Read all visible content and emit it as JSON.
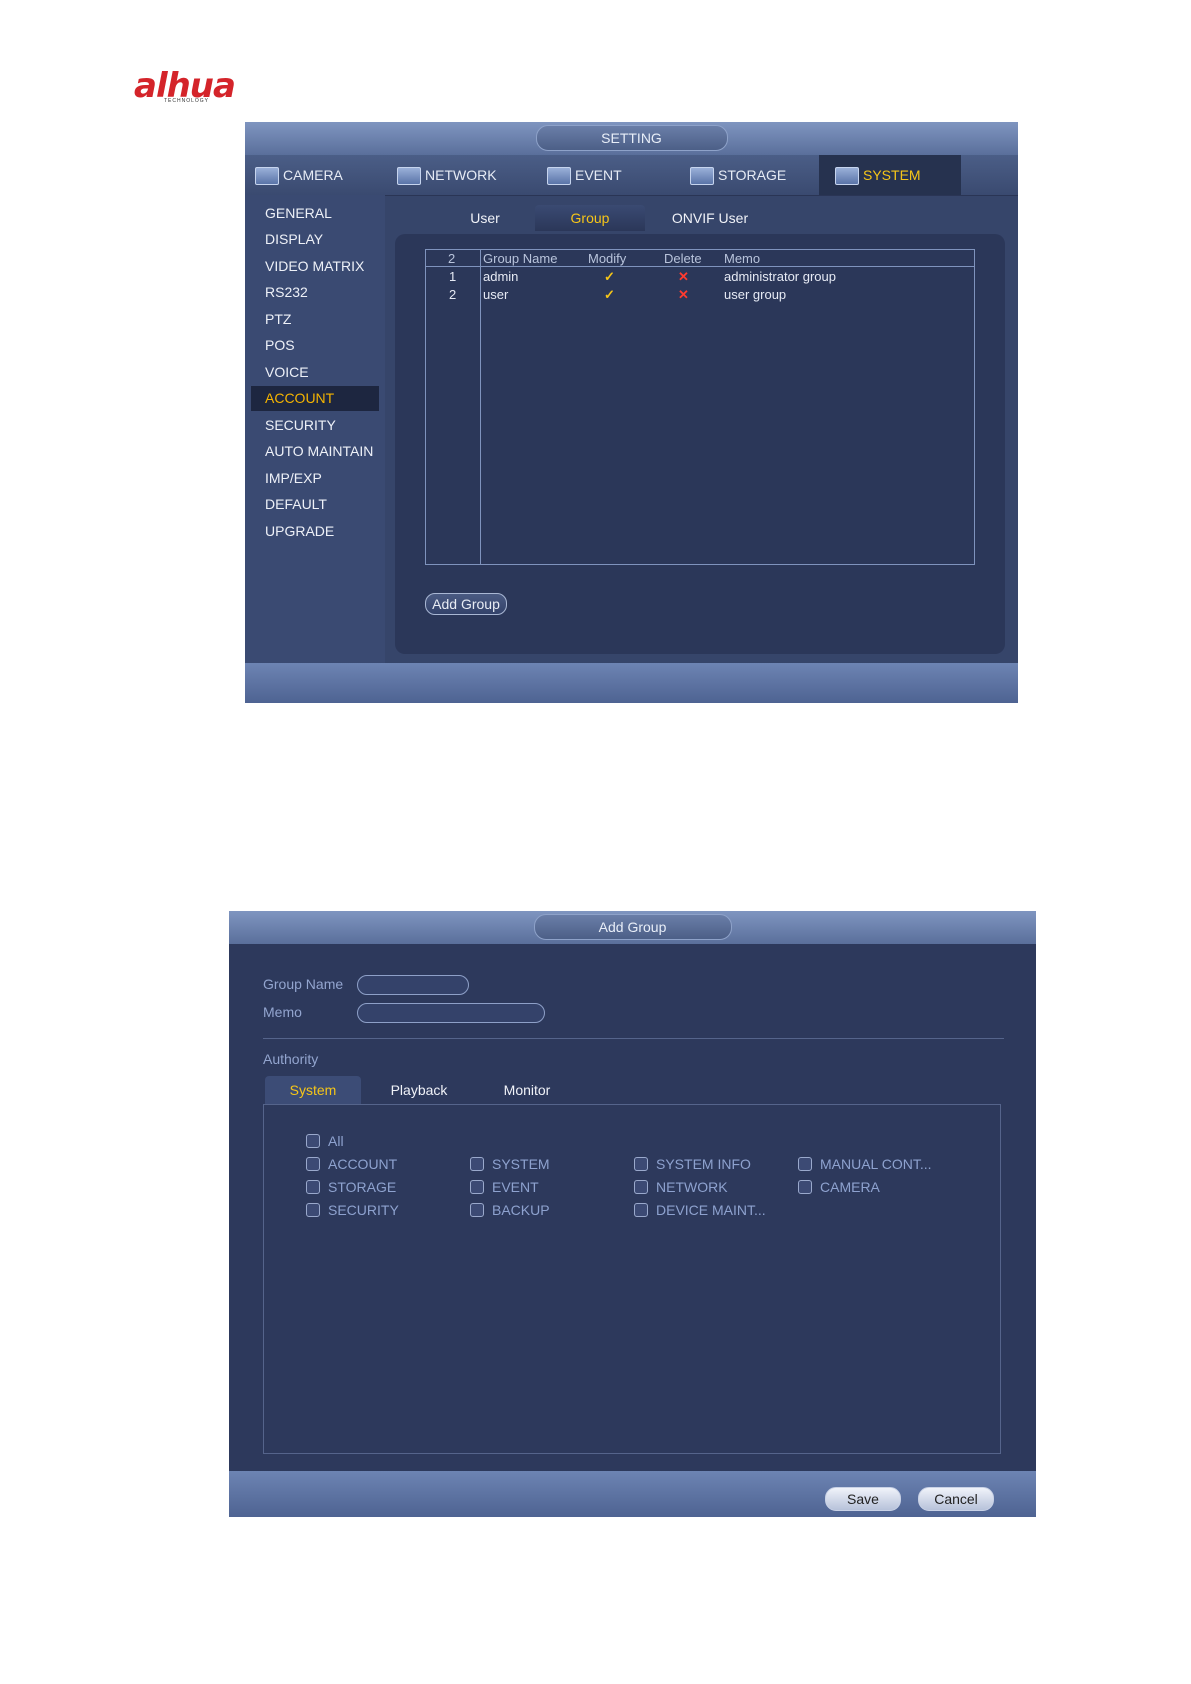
{
  "logo": {
    "brand": "alhua",
    "sub": "TECHNOLOGY"
  },
  "setting_window": {
    "title": "SETTING",
    "main_tabs": [
      {
        "label": "CAMERA",
        "icon": "camera-icon"
      },
      {
        "label": "NETWORK",
        "icon": "network-icon"
      },
      {
        "label": "EVENT",
        "icon": "event-icon"
      },
      {
        "label": "STORAGE",
        "icon": "storage-icon"
      },
      {
        "label": "SYSTEM",
        "icon": "system-icon",
        "active": true
      }
    ],
    "sidebar": [
      {
        "label": "GENERAL"
      },
      {
        "label": "DISPLAY"
      },
      {
        "label": "VIDEO MATRIX"
      },
      {
        "label": "RS232"
      },
      {
        "label": "PTZ"
      },
      {
        "label": "POS"
      },
      {
        "label": "VOICE"
      },
      {
        "label": "ACCOUNT",
        "active": true
      },
      {
        "label": "SECURITY"
      },
      {
        "label": "AUTO MAINTAIN"
      },
      {
        "label": "IMP/EXP"
      },
      {
        "label": "DEFAULT"
      },
      {
        "label": "UPGRADE"
      }
    ],
    "sub_tabs": [
      {
        "label": "User"
      },
      {
        "label": "Group",
        "active": true
      },
      {
        "label": "ONVIF User"
      }
    ],
    "table": {
      "count": "2",
      "headers": {
        "group_name": "Group Name",
        "modify": "Modify",
        "delete": "Delete",
        "memo": "Memo"
      },
      "rows": [
        {
          "index": "1",
          "name": "admin",
          "modify": "✓",
          "delete": "✕",
          "memo": "administrator group"
        },
        {
          "index": "2",
          "name": "user",
          "modify": "✓",
          "delete": "✕",
          "memo": "user group"
        }
      ]
    },
    "add_group_button": "Add Group"
  },
  "add_group_window": {
    "title": "Add Group",
    "group_name_label": "Group Name",
    "group_name_value": "",
    "memo_label": "Memo",
    "memo_value": "",
    "authority_label": "Authority",
    "authority_tabs": [
      {
        "label": "System",
        "active": true
      },
      {
        "label": "Playback"
      },
      {
        "label": "Monitor"
      }
    ],
    "permissions": {
      "all": "All",
      "col1": [
        "ACCOUNT",
        "STORAGE",
        "SECURITY"
      ],
      "col2": [
        "SYSTEM",
        "EVENT",
        "BACKUP"
      ],
      "col3": [
        "SYSTEM INFO",
        "NETWORK",
        "DEVICE MAINT..."
      ],
      "col4": [
        "MANUAL CONT...",
        "CAMERA"
      ]
    },
    "save_label": "Save",
    "cancel_label": "Cancel"
  },
  "colors": {
    "accent": "#f5c518",
    "panel": "#2b3759",
    "delete": "#ff3b2f"
  }
}
